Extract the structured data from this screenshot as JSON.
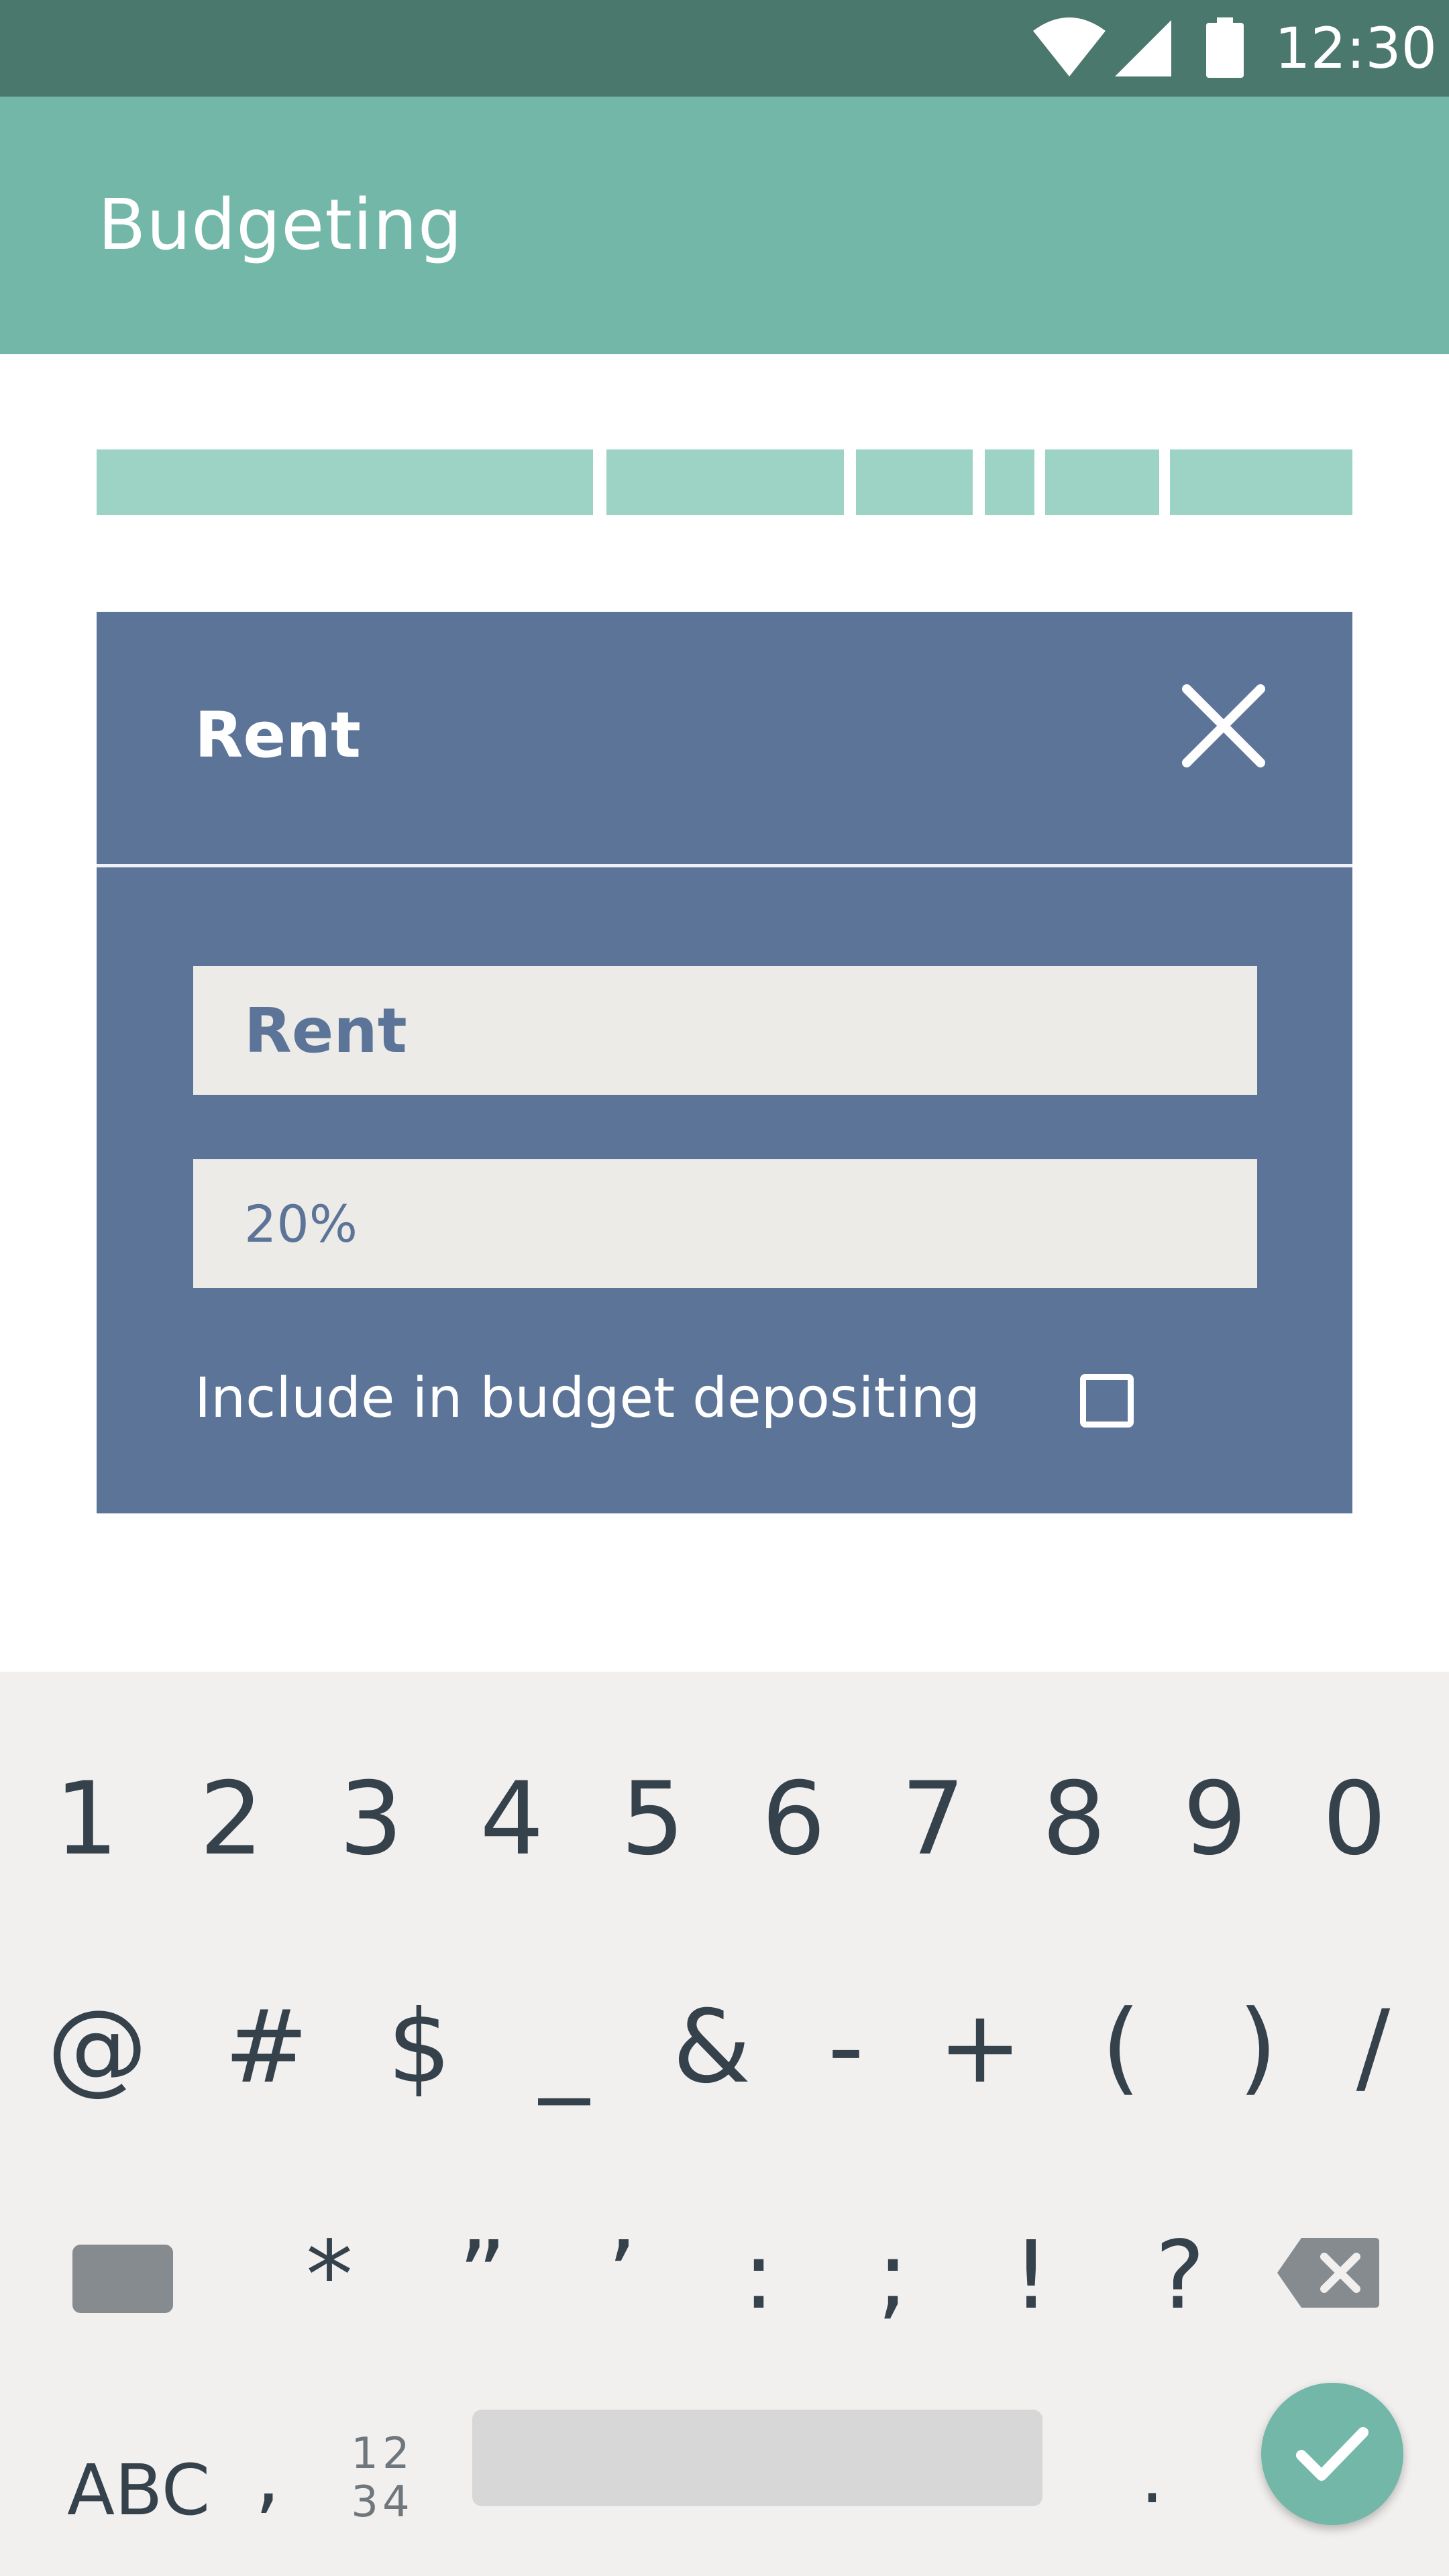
{
  "status_bar": {
    "time": "12:30",
    "icons": [
      "wifi-icon",
      "signal-icon",
      "battery-icon"
    ]
  },
  "app_bar": {
    "title": "Budgeting"
  },
  "budget_bar": {
    "segment_count": 6,
    "color": "#9cd3c5"
  },
  "dialog": {
    "title": "Rent",
    "close_icon": "close-icon",
    "name_field": {
      "value": "Rent"
    },
    "percent_field": {
      "value": "20%"
    },
    "checkbox": {
      "label": "Include in budget depositing",
      "checked": false
    }
  },
  "keyboard": {
    "row1": [
      "1",
      "2",
      "3",
      "4",
      "5",
      "6",
      "7",
      "8",
      "9",
      "0"
    ],
    "row2": [
      "@",
      "#",
      "$",
      "_",
      "&",
      "-",
      "+",
      "(",
      ")",
      "/"
    ],
    "row3": [
      "*",
      "”",
      "’",
      ":",
      ";",
      "!",
      "?"
    ],
    "abc_label": "ABC",
    "comma": ",",
    "numpad_top": "12",
    "numpad_bottom": "34",
    "period": ".",
    "done_icon": "check-icon",
    "backspace_icon": "backspace-icon"
  },
  "colors": {
    "status_bar": "#4b786c",
    "app_bar": "#73b7a8",
    "dialog": "#5b7497",
    "field": "#ecebe8",
    "keyboard": "#f2f0ef"
  }
}
